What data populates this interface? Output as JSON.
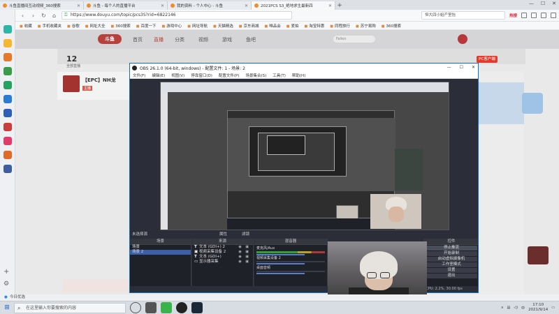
{
  "browser": {
    "tabs": [
      {
        "title": "斗鱼直播间互动视频_360搜索",
        "active": false
      },
      {
        "title": "斗鱼 - 每个人的直播平台",
        "active": false
      },
      {
        "title": "我的资料 - 个人中心 - 斗鱼",
        "active": false
      },
      {
        "title": "2021PCS S3_绝地求生最新四",
        "active": true
      }
    ],
    "new_tab": "+",
    "url": "https://www.douyu.com/topic/pcs3S?rid=6822146",
    "search_placeholder": "恒大四小姐产室怡",
    "hot_label": "热搜",
    "bookmarks": [
      "收藏",
      "手机收藏夹",
      "谷歌",
      "网址大全",
      "360搜索",
      "百度一下",
      "游戏中心",
      "网址导航",
      "天猫精选",
      "京东商城",
      "唯品会",
      "爱拍",
      "淘宝特惠",
      "同程旅行",
      "苏宁易购",
      "360搜索"
    ],
    "status_text": "今日优选"
  },
  "douyu": {
    "logo": "斗鱼",
    "nav": [
      "首页",
      "直播",
      "分类",
      "视频",
      "游戏",
      "鱼吧"
    ],
    "search_placeholder": "Fallen",
    "count": "12",
    "count_sub": "全部直播",
    "pc_badge": "PC客户端",
    "room_name": "【EPC】NH龙",
    "room_tag": "主播"
  },
  "obs": {
    "title": "OBS 26.1.0 (64-bit, windows) - 配置文件: 1 - 场景: 2",
    "menu": [
      "文件(F)",
      "编辑(E)",
      "视图(V)",
      "停靠窗口(D)",
      "配置文件(P)",
      "场景集合(S)",
      "工具(T)",
      "帮助(H)"
    ],
    "no_source": "未选择源",
    "tabs": {
      "props": "属性",
      "filters": "滤镜"
    },
    "scenes_header": "场景",
    "scenes": [
      {
        "name": "场景",
        "selected": false
      },
      {
        "name": "场景 2",
        "selected": true
      }
    ],
    "sources_header": "来源",
    "sources": [
      {
        "icon": "T",
        "name": "文本 (GDI+) 2"
      },
      {
        "icon": "▣",
        "name": "视频采集设备 2"
      },
      {
        "icon": "T",
        "name": "文本 (GDI+)"
      },
      {
        "icon": "▭",
        "name": "显示器采集"
      }
    ],
    "mixer_header": "混音器",
    "mixer": [
      {
        "name": "麦克风/Aux"
      },
      {
        "name": "视频采集设备 2"
      },
      {
        "name": "桌面音频"
      }
    ],
    "controls_header": "控件",
    "controls": [
      "停止推流",
      "开始录制",
      "启动虚拟摄像机",
      "工作室模式",
      "设置",
      "退出"
    ],
    "list_buttons": "+ − ∧ ∨",
    "status": "CPU: 2.2%, 30.00 fps",
    "window_buttons": {
      "min": "—",
      "max": "☐",
      "close": "✕"
    }
  },
  "taskbar": {
    "search_placeholder": "在这里输入你要搜索的内容",
    "time": "17:10",
    "date": "2021/9/14"
  },
  "colors": {
    "obs_bg": "#2b2e38",
    "obs_selected": "#3c5ea8",
    "douyu_red": "#b7423d",
    "taskbar": "#d8dde4"
  }
}
